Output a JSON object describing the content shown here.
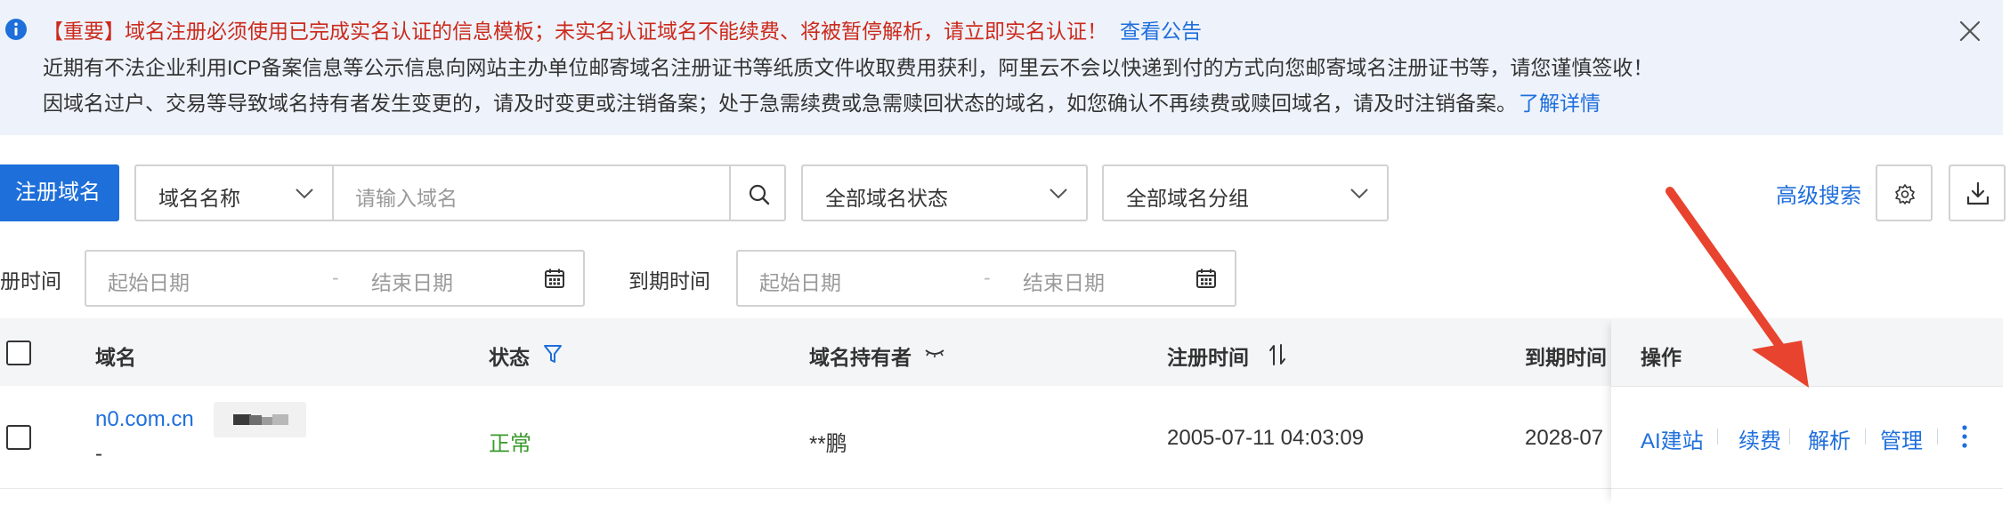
{
  "notice": {
    "icon": "info-icon",
    "line1": "【重要】域名注册必须使用已完成实名认证的信息模板；未实名认证域名不能续费、将被暂停解析，请立即实名认证！",
    "line1_link": "查看公告",
    "line2": "近期有不法企业利用ICP备案信息等公示信息向网站主办单位邮寄域名注册证书等纸质文件收取费用获利，阿里云不会以快递到付的方式向您邮寄域名注册证书等，请您谨慎签收！",
    "line3": "因域名过户、交易等导致域名持有者发生变更的，请及时变更或注销备案；处于急需续费或急需赎回状态的域名，如您确认不再续费或赎回域名，请及时注销备案。",
    "line3_link": "了解详情",
    "colors": {
      "background": "#eef3fb",
      "warning": "#cc2a1c",
      "link": "#1f6fdc"
    }
  },
  "toolbar": {
    "register_button": "注册域名",
    "search_type": "域名名称",
    "search_placeholder": "请输入域名",
    "status_filter": "全部域名状态",
    "group_filter": "全部域名分组",
    "advanced_search": "高级搜索",
    "primary_color": "#1e6fd9"
  },
  "filters": {
    "reg_time_label": "册时间",
    "expiry_time_label": "到期时间",
    "start_placeholder": "起始日期",
    "separator": "-",
    "end_placeholder": "结束日期"
  },
  "table": {
    "columns": [
      "域名",
      "状态",
      "域名持有者",
      "注册时间",
      "到期时间",
      "操作"
    ],
    "rows": [
      {
        "domain": "n0.com.cn",
        "sub": "-",
        "status": "正常",
        "holder": "**鹏",
        "reg_time": "2005-07-11 04:03:09",
        "expiry": "2028-07",
        "actions": [
          "AI建站",
          "续费",
          "解析",
          "管理"
        ]
      }
    ],
    "status_color": "#3a9a2c"
  },
  "annotation": {
    "arrow_color": "#e8432e"
  }
}
